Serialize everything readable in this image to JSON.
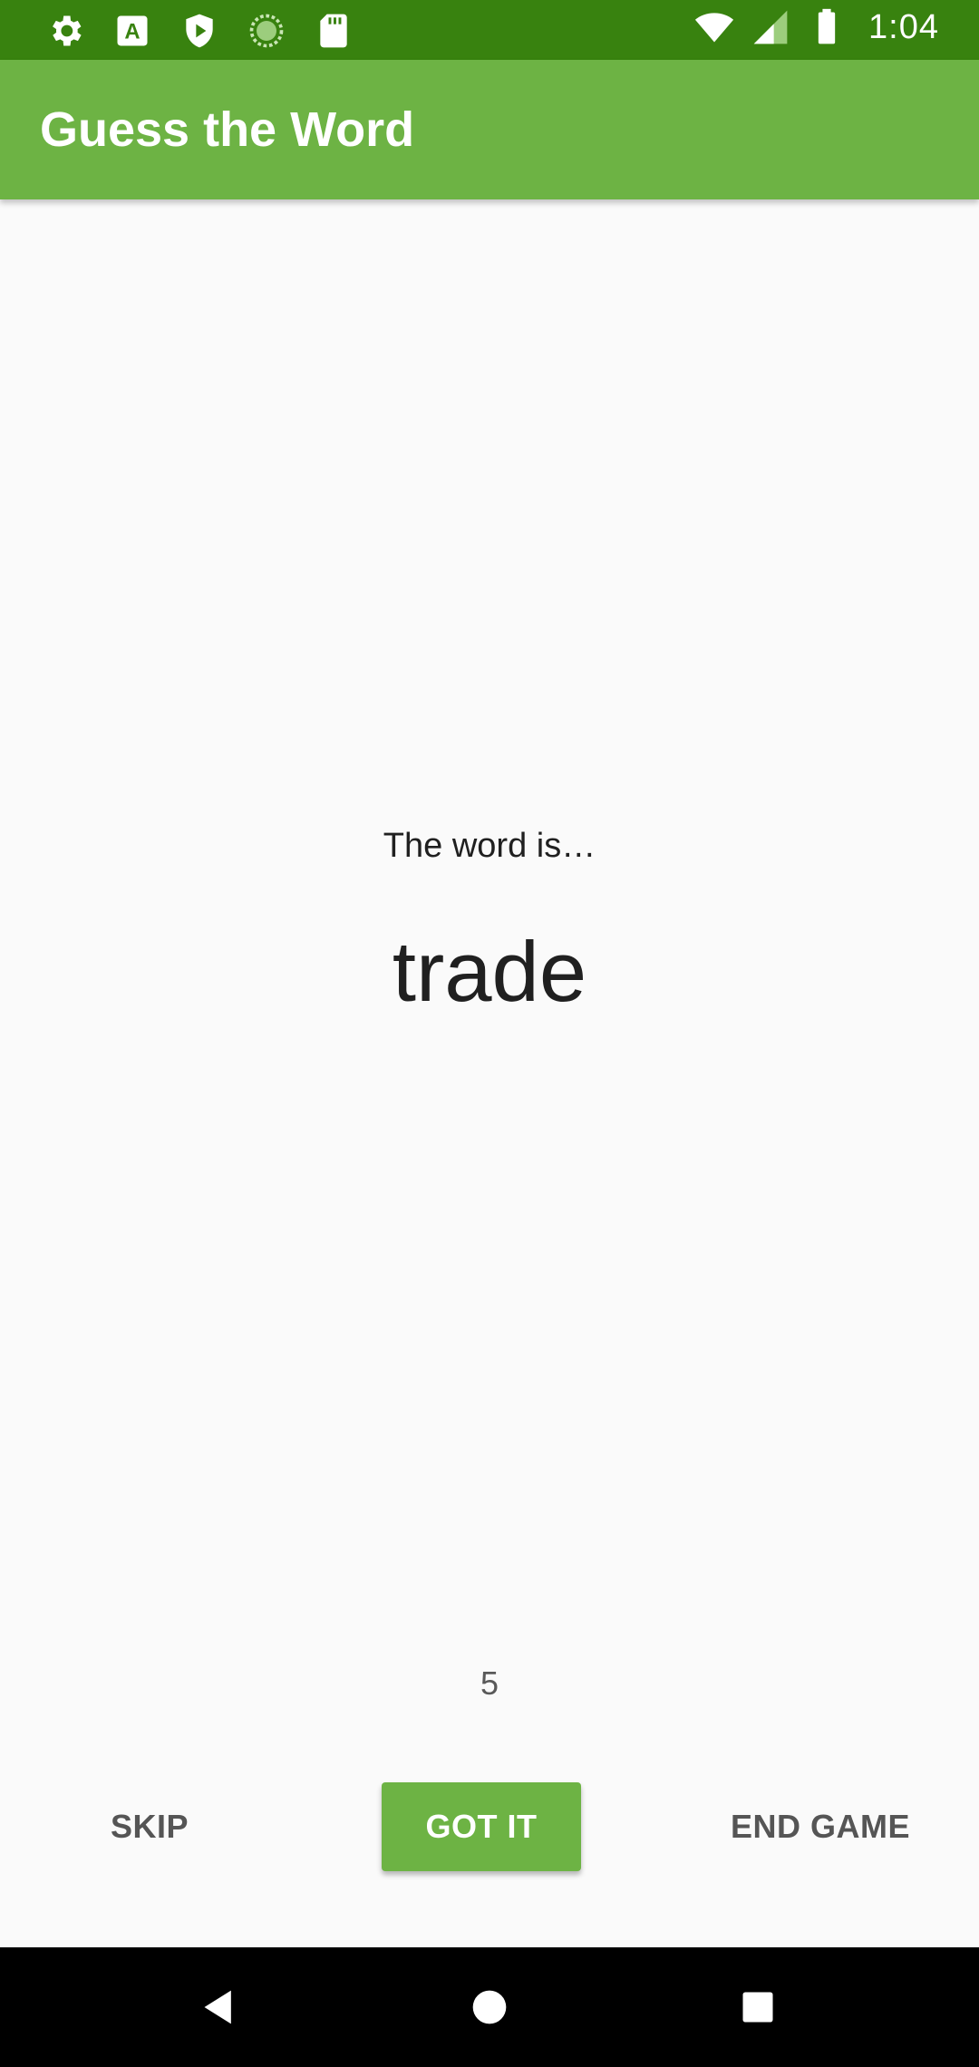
{
  "status_bar": {
    "time": "1:04",
    "left_icons": [
      "gear-icon",
      "font-a-icon",
      "shield-play-icon",
      "loading-circle-icon",
      "sd-card-icon"
    ],
    "right_icons": [
      "wifi-icon",
      "signal-icon",
      "battery-icon"
    ]
  },
  "app_bar": {
    "title": "Guess the Word"
  },
  "game": {
    "label": "The word is…",
    "word": "trade",
    "score": "5"
  },
  "buttons": {
    "skip": "SKIP",
    "got_it": "GOT IT",
    "end_game": "END GAME"
  },
  "nav_bar": {
    "icons": [
      "back-icon",
      "home-icon",
      "recents-icon"
    ]
  },
  "colors": {
    "status_bar": "#38820f",
    "app_bar": "#6db344",
    "accent": "#6db344",
    "background": "#fafafa"
  }
}
